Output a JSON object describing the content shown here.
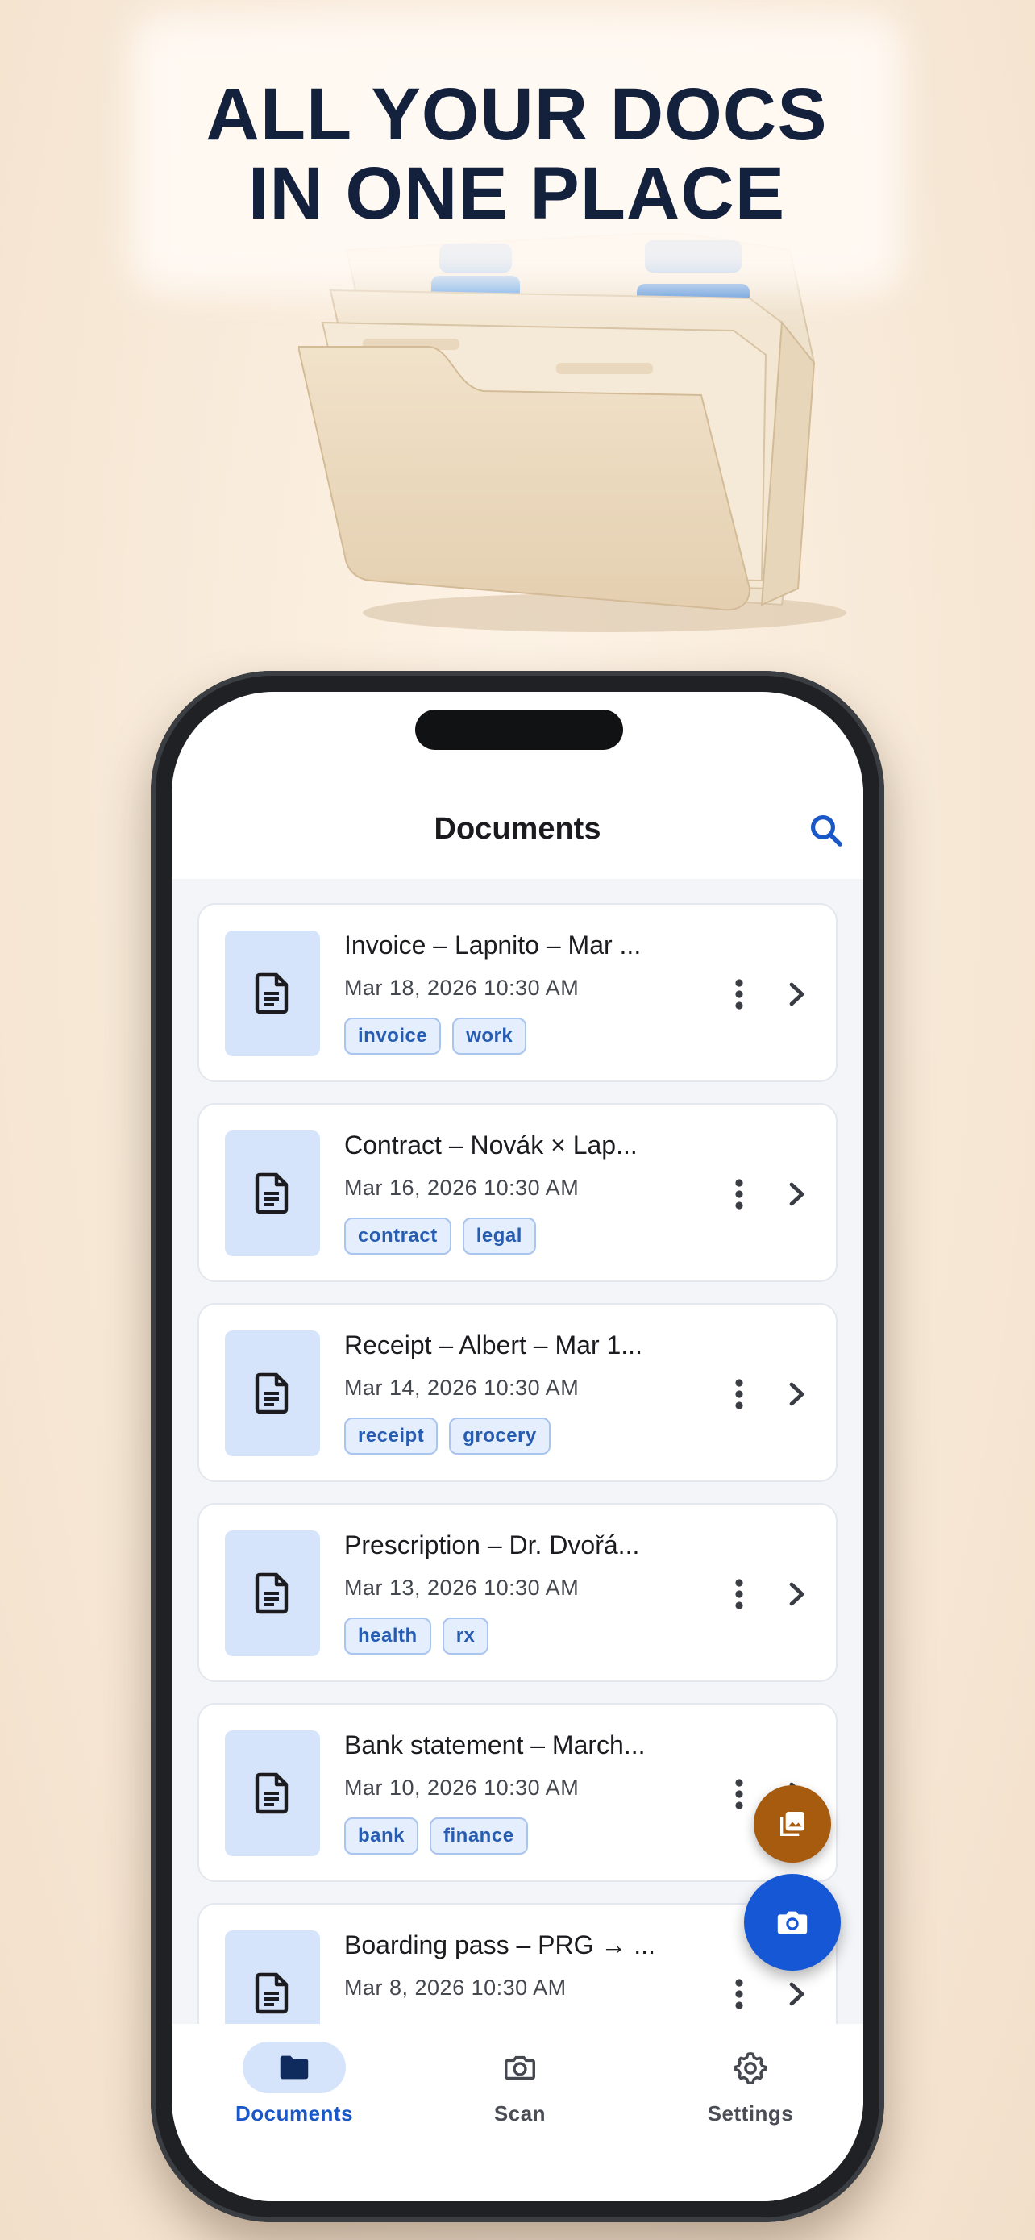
{
  "promo": {
    "headline_line1": "ALL YOUR DOCS",
    "headline_line2": "IN ONE PLACE"
  },
  "app": {
    "title": "Documents",
    "search_icon": "search-icon"
  },
  "documents": [
    {
      "title": "Invoice – Lapnito – Mar ...",
      "date": "Mar 18, 2026 10:30 AM",
      "tags": [
        "invoice",
        "work"
      ]
    },
    {
      "title": "Contract – Novák × Lap...",
      "date": "Mar 16, 2026 10:30 AM",
      "tags": [
        "contract",
        "legal"
      ]
    },
    {
      "title": "Receipt – Albert – Mar 1...",
      "date": "Mar 14, 2026 10:30 AM",
      "tags": [
        "receipt",
        "grocery"
      ]
    },
    {
      "title": "Prescription – Dr. Dvořá...",
      "date": "Mar 13, 2026 10:30 AM",
      "tags": [
        "health",
        "rx"
      ]
    },
    {
      "title": "Bank statement – March...",
      "date": "Mar 10, 2026 10:30 AM",
      "tags": [
        "bank",
        "finance"
      ]
    },
    {
      "title": "Boarding pass – PRG → ...",
      "date": "Mar 8, 2026 10:30 AM",
      "tags": []
    }
  ],
  "fabs": {
    "gallery_icon": "image-gallery-icon",
    "camera_icon": "camera-icon"
  },
  "nav": {
    "items": [
      {
        "label": "Documents",
        "icon": "folder-icon",
        "active": true
      },
      {
        "label": "Scan",
        "icon": "camera-icon",
        "active": false
      },
      {
        "label": "Settings",
        "icon": "gear-icon",
        "active": false
      }
    ]
  },
  "colors": {
    "primary": "#1a58c8",
    "fab_gallery": "#a65b0f",
    "fab_camera": "#1657d6",
    "thumb_bg": "#d6e4fb",
    "headline": "#14213d"
  }
}
